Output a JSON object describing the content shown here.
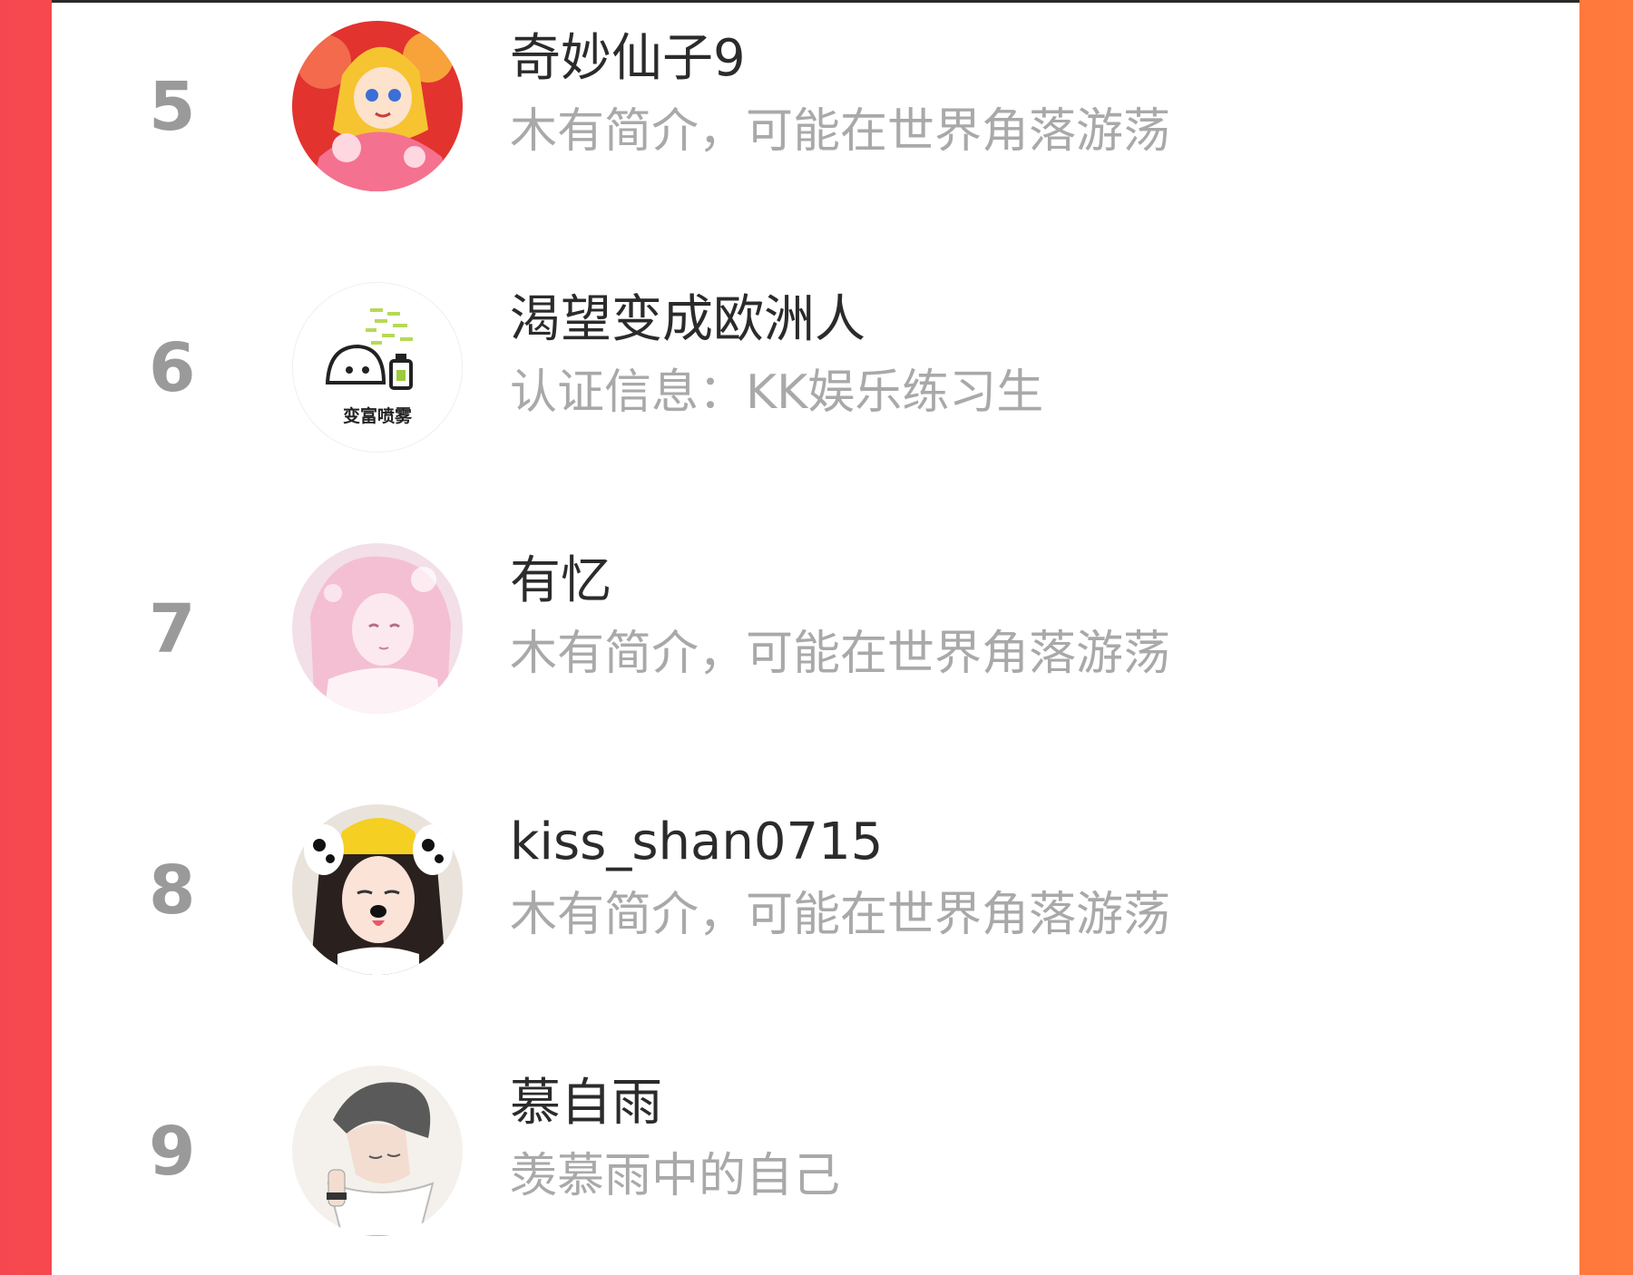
{
  "colors": {
    "background_left": "#f5474f",
    "background_right": "#ff7a3c",
    "card": "#ffffff",
    "rank_number": "#9a9a9a",
    "name": "#2b2b2b",
    "bio": "#a9a9a9"
  },
  "ranking": {
    "entries": [
      {
        "rank": "5",
        "name": "奇妙仙子9",
        "bio": "木有简介，可能在世界角落游荡",
        "avatar_icon": "cartoon-princess-avatar"
      },
      {
        "rank": "6",
        "name": "渴望变成欧洲人",
        "bio": "认证信息：KK娱乐练习生",
        "avatar_icon": "cartoon-spray-avatar",
        "avatar_caption": "变富喷雾"
      },
      {
        "rank": "7",
        "name": "有忆",
        "bio": "木有简介，可能在世界角落游荡",
        "avatar_icon": "pink-anime-girl-avatar"
      },
      {
        "rank": "8",
        "name": "kiss_shan0715",
        "bio": "木有简介，可能在世界角落游荡",
        "avatar_icon": "girl-dog-filter-avatar"
      },
      {
        "rank": "9",
        "name": "慕自雨",
        "bio": "羡慕雨中的自己",
        "avatar_icon": "sketch-boy-avatar"
      }
    ]
  }
}
